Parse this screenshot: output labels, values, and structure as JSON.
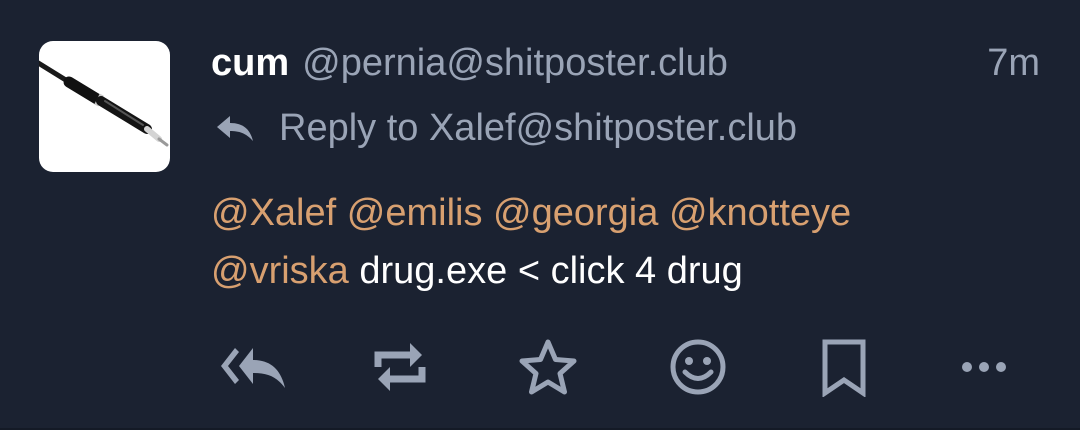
{
  "status": {
    "display_name": "cum",
    "account": "@pernia@shitposter.club",
    "timestamp": "7m",
    "reply_to": "Reply to Xalef@shitposter.club",
    "mentions_line1": [
      "@Xalef",
      "@emilis",
      "@georgia",
      "@knotteye"
    ],
    "mention_line2": "@vriska",
    "text": "drug.exe < click 4 drug",
    "avatar_icon": "pen-icon"
  },
  "actions": [
    {
      "name": "reply-all-icon"
    },
    {
      "name": "repeat-icon"
    },
    {
      "name": "favorite-star-icon"
    },
    {
      "name": "emoji-reaction-icon"
    },
    {
      "name": "bookmark-icon"
    },
    {
      "name": "more-options-icon"
    }
  ],
  "colors": {
    "background": "#1b2231",
    "mention": "#d8a070",
    "muted": "#9aa4b6",
    "text": "#ffffff",
    "icon": "#9aa4b6"
  }
}
